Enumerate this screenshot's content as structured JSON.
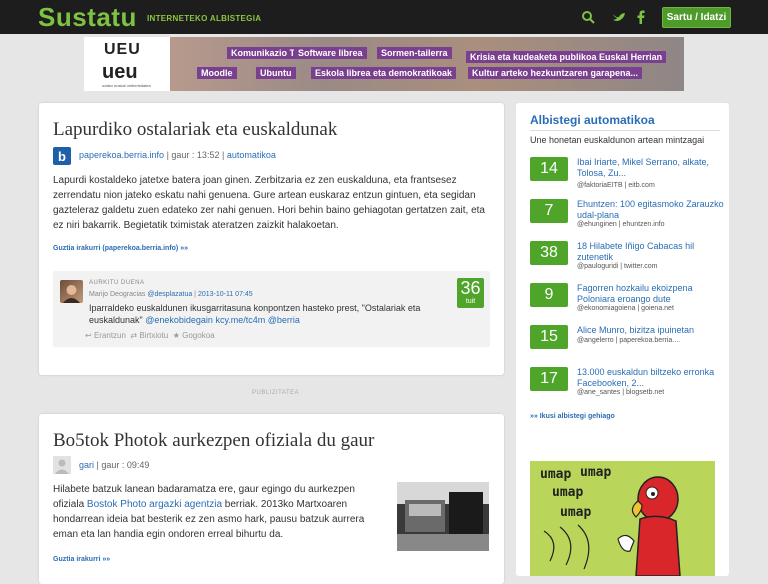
{
  "header": {
    "logo": "Sustatu",
    "tagline": "INTERNETEKO ALBISTEGIA",
    "login_label": "Sartu / Idatzi",
    "icons": [
      "search-icon",
      "twitter-icon",
      "facebook-icon"
    ]
  },
  "banner": {
    "logo_mark": "UEU",
    "logo_name": "ueu",
    "logo_small": "udako euskal unibertsitatea",
    "tags": [
      "Komunikazio Tailerra",
      "Software librea",
      "Sormen-tailerra",
      "Krisia eta kudeaketa publikoa Euskal Herrian",
      "Moodle",
      "Ubuntu",
      "Eskola librea eta demokratikoak",
      "Kultur arteko hezkuntzaren garapena..."
    ]
  },
  "posts": [
    {
      "title": "Lapurdiko ostalariak eta euskaldunak",
      "source": "paperekoa.berria.info",
      "time_label": "| gaur : 13:52 |",
      "category": "automatikoa",
      "body": "Lapurdi kostaldeko jatetxe batera joan ginen. Zerbitzaria ez zen euskalduna, eta frantsesez zerrendatu nion jateko eskatu nahi genuena. Gure artean euskaraz entzun gintuen, eta segidan gazteleraz galdetu zuen edateko zer nahi genuen. Hori behin baino gehiagotan gertatzen zait, eta ez niri bakarrik. Begietatik tximistak ateratzen zaizkit halakoetan.",
      "readmore": "Guztia irakurri (paperekoa.berria.info) »»",
      "tweet": {
        "heading": "AURKITU DUENA",
        "author": "Marijo Deogracias",
        "handle": "@desplazatua",
        "date": "2013-10-11 07:45",
        "text_plain": "Iparraldeko euskaldunen ikusgarritasuna konpontzen hasteko prest, \"Ostalariak eta euskaldunak\"",
        "links": "@enekobidegain kcy.me/tc4m @berria",
        "count": "36",
        "count_unit": "tuit",
        "actions": [
          "Erantzun",
          "Birtxiotu",
          "Gogokoa"
        ]
      }
    },
    {
      "title": "Bo5tok Photok aurkezpen ofiziala du gaur",
      "author": "gari",
      "time_label": "| gaur : 09:49",
      "body_before_link": "Hilabete batzuk lanean badaramatza ere, gaur egingo du aurkezpen ofiziala",
      "link": "Bostok Photo argazki agentzia",
      "body_after_link": "berriak. 2013ko Martxoaren hondarrean ideia bat besterik ez zen asmo hark, pausu batzuk aurrera eman eta lan handia egin ondoren erreal bihurtu da.",
      "readmore": "Guztia irakurri »»"
    }
  ],
  "ad_label": "PUBLIZITATEA",
  "sidebar": {
    "title": "Albistegi automatikoa",
    "subtitle": "Une honetan euskaldunon artean mintzagai",
    "items": [
      {
        "count": "14",
        "title": "Ibai Iriarte, Mikel Serrano, alkate, Tolosa, Zu...",
        "source": "@faktoriaEITB | eitb.com"
      },
      {
        "count": "7",
        "title": "Ehuntzen: 100 egitasmoko Zarauzko udal-plana",
        "source": "@ehunginen | ehuntzen.info"
      },
      {
        "count": "38",
        "title": "18 Hilabete Iñigo Cabacas hil zutenetik",
        "source": "@pauloguridi | twitter.com"
      },
      {
        "count": "9",
        "title": "Fagorren hozkailu ekoizpena Poloniara eroango dute",
        "source": "@ekonomiagoiena | goiena.net"
      },
      {
        "count": "15",
        "title": "Alice Munro, bizitza ipuinetan",
        "source": "@angelerro | paperekoa.berria...."
      },
      {
        "count": "17",
        "title": "13.000 euskaldun biltzeko erronka Facebooken, 2...",
        "source": "@ane_santes | blogsetb.net"
      }
    ],
    "more": "»» Ikusi albistegi gehiago",
    "cartoon_words": [
      "umap",
      "umap",
      "umap",
      "umap"
    ]
  },
  "colors": {
    "topbar": "#1d1d1d",
    "brand_green": "#7dc242",
    "count_green": "#4ea52a",
    "link_blue": "#2a6db5"
  }
}
